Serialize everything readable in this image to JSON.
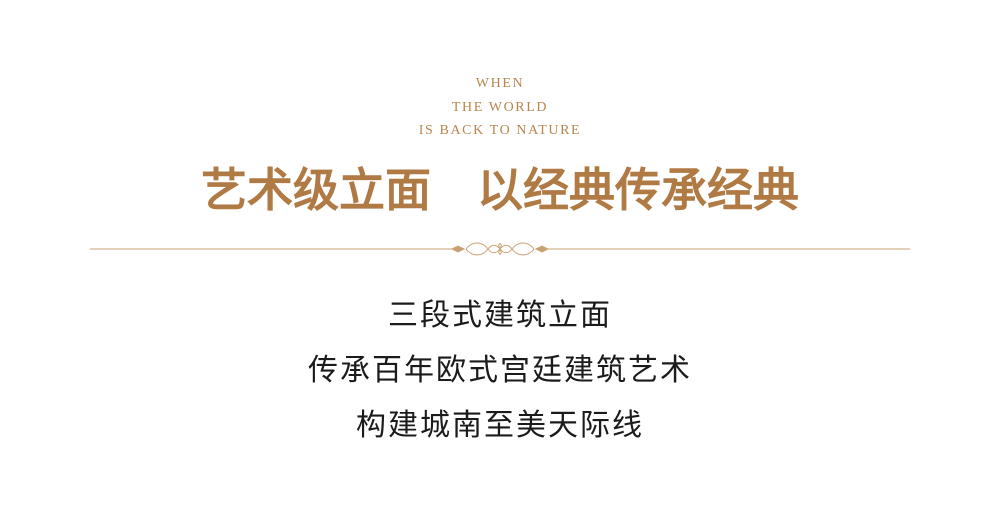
{
  "english_lines": [
    "WHEN",
    "THE WORLD",
    "IS BACK TO NATURE"
  ],
  "headline": "艺术级立面　以经典传承经典",
  "body_lines": [
    "三段式建筑立面",
    "传承百年欧式宫廷建筑艺术",
    "构建城南至美天际线"
  ],
  "colors": {
    "gold": "#b8864f",
    "headline_gold": "#b07a45",
    "body_text": "#1b1b1b",
    "background": "#ffffff"
  },
  "ornament": "ornamental-divider-icon"
}
